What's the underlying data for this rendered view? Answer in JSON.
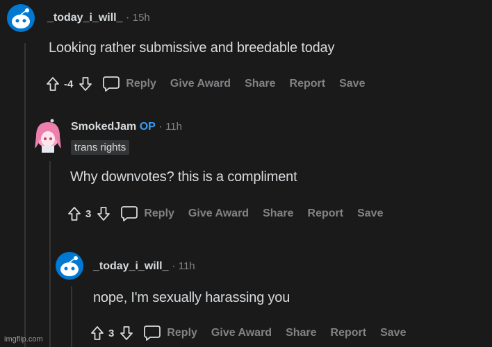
{
  "colors": {
    "background": "#1a1a1b",
    "text": "#d7dadc",
    "muted": "#818384",
    "op": "#3a9cf0"
  },
  "comments": [
    {
      "username": "_today_i_will_",
      "time": "15h",
      "separator": "·",
      "body": "Looking rather submissive and breedable today",
      "score": "-4",
      "actions": {
        "reply": "Reply",
        "give_award": "Give Award",
        "share": "Share",
        "report": "Report",
        "save": "Save"
      }
    },
    {
      "username": "SmokedJam",
      "op_badge": "OP",
      "time": "11h",
      "separator": "·",
      "flair": "trans rights",
      "body": "Why downvotes? this is a compliment",
      "score": "3",
      "actions": {
        "reply": "Reply",
        "give_award": "Give Award",
        "share": "Share",
        "report": "Report",
        "save": "Save"
      }
    },
    {
      "username": "_today_i_will_",
      "time": "11h",
      "separator": "·",
      "body": "nope, I'm sexually harassing you",
      "score": "3",
      "actions": {
        "reply": "Reply",
        "give_award": "Give Award",
        "share": "Share",
        "report": "Report",
        "save": "Save"
      }
    }
  ],
  "watermark": "imgflip.com"
}
